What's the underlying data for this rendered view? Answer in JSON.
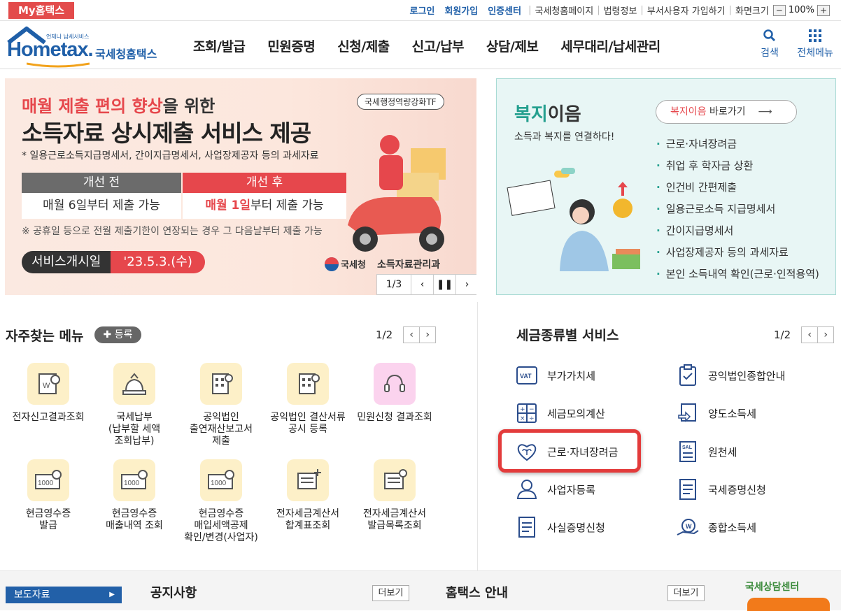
{
  "topbar": {
    "my_label": "My홈택스",
    "links_blue": [
      "로그인",
      "회원가입",
      "인증센터"
    ],
    "links_gray": [
      "국세청홈페이지",
      "법령정보",
      "부서사용자 가입하기",
      "화면크기"
    ],
    "zoom": "100%"
  },
  "header": {
    "logo_small": "언제나 납세서비스",
    "logo_main": "Hometax.",
    "logo_sub": "국세청홈택스",
    "nav": [
      "조회/발급",
      "민원증명",
      "신청/제출",
      "신고/납부",
      "상담/제보",
      "세무대리/납세관리"
    ],
    "search_label": "검색",
    "allmenu_label": "전체메뉴"
  },
  "banner": {
    "line1_red": "매월 제출 편의 향상",
    "line1_rest": "을 위한",
    "line2": "소득자료 상시제출 서비스 제공",
    "line3": "* 일용근로소득지급명세서, 간이지급명세서, 사업장제공자 등의 과세자료",
    "tf": "국세행정역량강화TF",
    "before_head": "개선 전",
    "after_head": "개선 후",
    "before_val": "매월 6일부터 제출 가능",
    "after_val_red": "매월 1일",
    "after_val_rest": "부터 제출 가능",
    "note": "※ 공휴일 등으로 전월 제출기한이 연장되는 경우 그 다음날부터 제출 가능",
    "date_label": "서비스개시일",
    "date_value": "'23.5.3.(수)",
    "org": "국세청",
    "org2": "소득자료관리과",
    "page": "1/3"
  },
  "welfare": {
    "title_green": "복지",
    "title_rest": "이음",
    "subtitle": "소득과 복지를 연결하다!",
    "go_red": "복지이음",
    "go_rest": "바로가기",
    "items": [
      "근로·자녀장려금",
      "취업 후 학자금 상환",
      "인건비 간편제출",
      "일용근로소득 지급명세서",
      "간이지급명세서",
      "사업장제공자 등의 과세자료",
      "본인 소득내역 확인(근로·인적용역)"
    ]
  },
  "favorites": {
    "title": "자주찾는 메뉴",
    "register": "등록",
    "page": "1/2",
    "items": [
      "전자신고결과조회",
      "국세납부\n(납부할 세액\n조회납부)",
      "공익법인\n출연재산보고서\n제출",
      "공익법인 결산서류\n공시 등록",
      "민원신청 결과조회",
      "현금영수증\n발급",
      "현금영수증\n매출내역 조회",
      "현금영수증\n매입세액공제\n확인/변경(사업자)",
      "전자세금계산서\n합계표조회",
      "전자세금계산서\n발급목록조회"
    ]
  },
  "taxservice": {
    "title": "세금종류별 서비스",
    "page": "1/2",
    "left": [
      "부가가치세",
      "세금모의계산",
      "근로·자녀장려금",
      "사업자등록",
      "사실증명신청"
    ],
    "right": [
      "공익법인종합안내",
      "양도소득세",
      "원천세",
      "국세증명신청",
      "종합소득세"
    ]
  },
  "bottom": {
    "press": "보도자료",
    "notice": "공지사항",
    "more": "더보기",
    "guide": "홈택스 안내",
    "center": "국세상담센터"
  }
}
